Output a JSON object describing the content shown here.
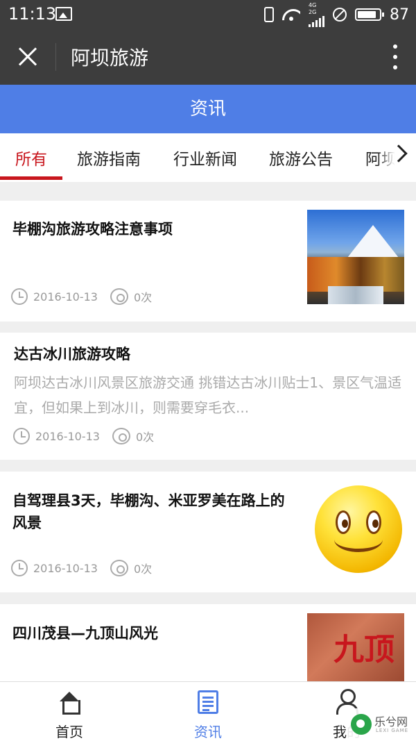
{
  "status_bar": {
    "time": "11:13",
    "signal_text": "4G 2G",
    "battery_percent": "87"
  },
  "title_bar": {
    "title": "阿坝旅游"
  },
  "header": {
    "title": "资讯"
  },
  "tabs": [
    {
      "label": "所有",
      "active": true
    },
    {
      "label": "旅游指南"
    },
    {
      "label": "行业新闻"
    },
    {
      "label": "旅游公告"
    },
    {
      "label": "阿坝"
    }
  ],
  "articles": [
    {
      "title": "毕棚沟旅游攻略注意事项",
      "date": "2016-10-13",
      "views": "0次",
      "thumbnail": "mountain-photo"
    },
    {
      "title": "达古冰川旅游攻略",
      "summary": "阿坝达古冰川风景区旅游交通 挑错达古冰川贴士1、景区气温适宜，但如果上到冰川，则需要穿毛衣...",
      "date": "2016-10-13",
      "views": "0次"
    },
    {
      "title": "自驾理县3天，毕棚沟、米亚罗美在路上的风景",
      "date": "2016-10-13",
      "views": "0次",
      "thumbnail": "smiley-emoji"
    },
    {
      "title": "四川茂县—九顶山风光",
      "thumbnail": "calligraphy-stone",
      "thumbnail_text": "九顶"
    }
  ],
  "bottom_nav": [
    {
      "label": "首页",
      "icon": "home-icon"
    },
    {
      "label": "资讯",
      "icon": "news-icon",
      "active": true
    },
    {
      "label": "我的",
      "icon": "user-icon"
    }
  ],
  "watermark": {
    "text": "乐兮网",
    "sub": "LEXI GAME"
  },
  "colors": {
    "accent_blue": "#4f7ee6",
    "active_red": "#c8161d",
    "bar_dark": "#3d3d3d"
  }
}
